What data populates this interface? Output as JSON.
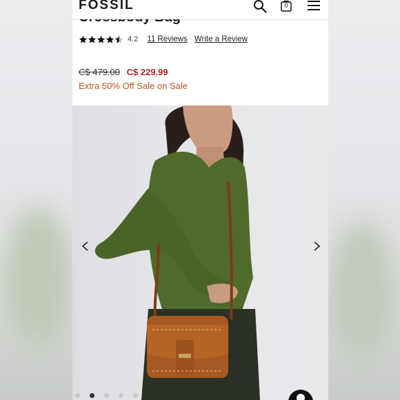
{
  "header": {
    "logo": "FOSSIL",
    "bag_count": "0",
    "icons": [
      "search-icon",
      "shopping-bag-icon",
      "hamburger-menu-icon"
    ]
  },
  "product": {
    "title": "Crossbody Bag",
    "rating_value": "4.2",
    "rating_fraction": 0.84,
    "reviews_link": "11 Reviews",
    "write_review_link": "Write a Review",
    "original_price": "C$ 479.00",
    "sale_price": "C$ 229.99",
    "promo_text": "Extra 50% Off Sale on Sale"
  },
  "gallery": {
    "image_count": 5,
    "active_index": 1,
    "prev_icon": "chevron-left-icon",
    "next_icon": "chevron-right-icon"
  },
  "colors": {
    "sale_price": "#b4232a",
    "promo": "#b5561c",
    "text": "#1a1a1a"
  }
}
